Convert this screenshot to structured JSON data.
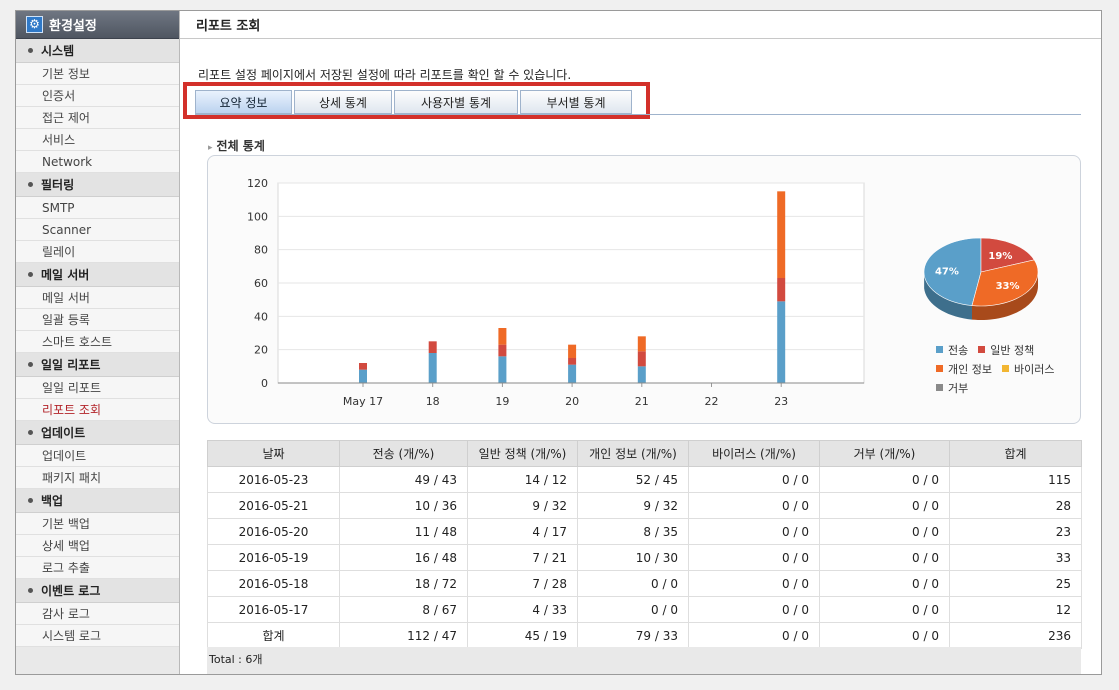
{
  "sidebar": {
    "header": "환경설정",
    "sections": [
      {
        "title": "시스템",
        "items": [
          "기본 정보",
          "인증서",
          "접근 제어",
          "서비스",
          "Network"
        ]
      },
      {
        "title": "필터링",
        "items": [
          "SMTP",
          "Scanner",
          "릴레이"
        ]
      },
      {
        "title": "메일 서버",
        "items": [
          "메일 서버",
          "일괄 등록",
          "스마트 호스트"
        ]
      },
      {
        "title": "일일 리포트",
        "items": [
          "일일 리포트",
          "리포트 조회"
        ]
      },
      {
        "title": "업데이트",
        "items": [
          "업데이트",
          "패키지 패치"
        ]
      },
      {
        "title": "백업",
        "items": [
          "기본 백업",
          "상세 백업",
          "로그 추출"
        ]
      },
      {
        "title": "이벤트 로그",
        "items": [
          "감사 로그",
          "시스템 로그"
        ]
      }
    ],
    "active_item": "리포트 조회"
  },
  "page": {
    "title": "리포트 조회",
    "description": "리포트 설정 페이지에서 저장된 설정에 따라 리포트를 확인 할 수 있습니다.",
    "tabs": [
      {
        "label": "요약 정보",
        "active": true
      },
      {
        "label": "상세 통계",
        "active": false
      },
      {
        "label": "사용자별 통계",
        "active": false
      },
      {
        "label": "부서별 통계",
        "active": false
      }
    ],
    "section_title": "전체 통계",
    "total_label": "Total : 6개"
  },
  "colors": {
    "transmit": "#5a9fc9",
    "policy": "#d24a3f",
    "personal": "#ef6a26",
    "virus": "#f2b632",
    "reject": "#8a8a8a"
  },
  "chart_data": [
    {
      "type": "bar",
      "stacked": true,
      "categories": [
        "May 17",
        "18",
        "19",
        "20",
        "21",
        "22",
        "23"
      ],
      "series": [
        {
          "name": "전송",
          "values": [
            8,
            18,
            16,
            11,
            10,
            0,
            49
          ]
        },
        {
          "name": "일반 정책",
          "values": [
            4,
            7,
            7,
            4,
            9,
            0,
            14
          ]
        },
        {
          "name": "개인 정보",
          "values": [
            0,
            0,
            10,
            8,
            9,
            0,
            52
          ]
        }
      ],
      "yticks": [
        0,
        20,
        40,
        60,
        80,
        100,
        120
      ],
      "ylim": [
        0,
        120
      ],
      "grid": true
    },
    {
      "type": "pie",
      "labels": [
        "전송",
        "일반 정책",
        "개인 정보",
        "바이러스",
        "거부"
      ],
      "values": [
        47,
        19,
        33,
        0,
        0
      ],
      "value_labels": [
        "47%",
        "19%",
        "33%"
      ],
      "legend": "bottom"
    }
  ],
  "table": {
    "headers": [
      "날짜",
      "전송 (개/%)",
      "일반 정책 (개/%)",
      "개인 정보 (개/%)",
      "바이러스 (개/%)",
      "거부 (개/%)",
      "합계"
    ],
    "rows": [
      [
        "2016-05-23",
        "49 / 43",
        "14 / 12",
        "52 / 45",
        "0 / 0",
        "0 / 0",
        "115"
      ],
      [
        "2016-05-21",
        "10 / 36",
        "9 / 32",
        "9 / 32",
        "0 / 0",
        "0 / 0",
        "28"
      ],
      [
        "2016-05-20",
        "11 / 48",
        "4 / 17",
        "8 / 35",
        "0 / 0",
        "0 / 0",
        "23"
      ],
      [
        "2016-05-19",
        "16 / 48",
        "7 / 21",
        "10 / 30",
        "0 / 0",
        "0 / 0",
        "33"
      ],
      [
        "2016-05-18",
        "18 / 72",
        "7 / 28",
        "0 / 0",
        "0 / 0",
        "0 / 0",
        "25"
      ],
      [
        "2016-05-17",
        "8 / 67",
        "4 / 33",
        "0 / 0",
        "0 / 0",
        "0 / 0",
        "12"
      ]
    ],
    "total_row": [
      "합계",
      "112 / 47",
      "45 / 19",
      "79 / 33",
      "0 / 0",
      "0 / 0",
      "236"
    ]
  }
}
